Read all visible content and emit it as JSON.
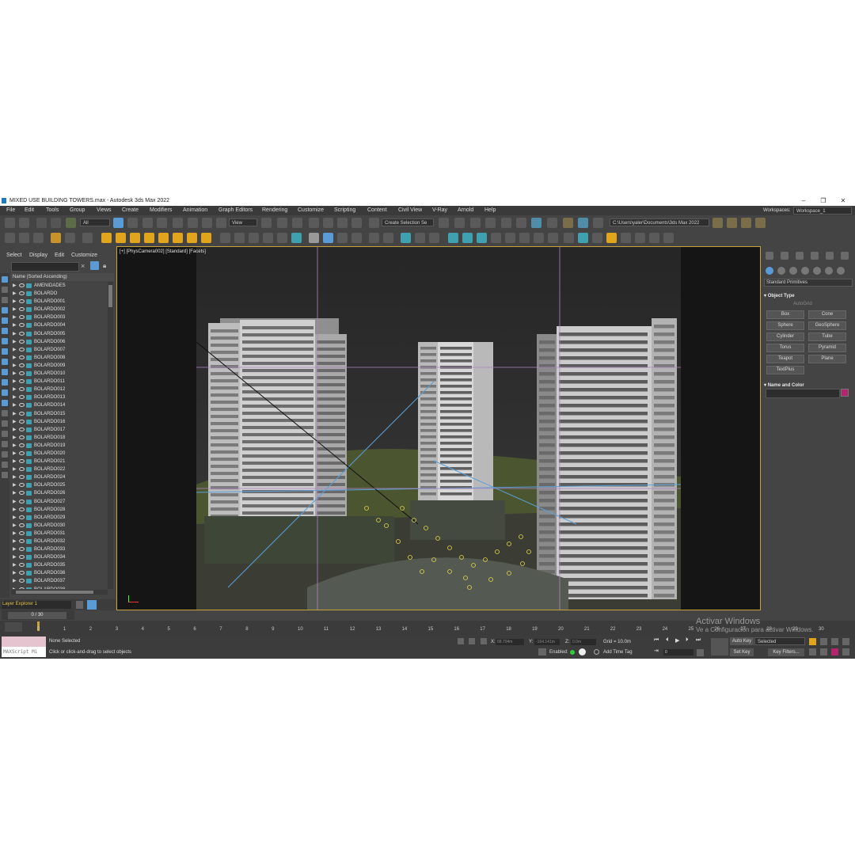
{
  "window": {
    "title": "MIXED USE BUILDING TOWERS.max - Autodesk 3ds Max 2022",
    "minimize": "–",
    "maximize": "❐",
    "close": "✕"
  },
  "menu": [
    "File",
    "Edit",
    "Tools",
    "Group",
    "Views",
    "Create",
    "Modifiers",
    "Animation",
    "Graph Editors",
    "Rendering",
    "Customize",
    "Scripting",
    "Content",
    "Civil View",
    "V-Ray",
    "Arnold",
    "Help"
  ],
  "workspaces": {
    "label": "Workspaces:",
    "value": "Workspace_1"
  },
  "toolbar": {
    "filter_value": "All",
    "view_value": "View",
    "selection_set": "Create Selection Se",
    "project_path": "C:\\Users\\yaler\\Documents\\3ds Max 2022"
  },
  "scene_explorer": {
    "menu": [
      "Select",
      "Display",
      "Edit",
      "Customize"
    ],
    "column_header": "Name (Sorted Ascending)",
    "items": [
      "AMENIDADES",
      "BOLARDO",
      "BOLARDO001",
      "BOLARDO002",
      "BOLARDO003",
      "BOLARDO004",
      "BOLARDO005",
      "BOLARDO006",
      "BOLARDO007",
      "BOLARDO008",
      "BOLARDO009",
      "BOLARDO010",
      "BOLARDO011",
      "BOLARDO012",
      "BOLARDO013",
      "BOLARDO014",
      "BOLARDO015",
      "BOLARDO016",
      "BOLARDO017",
      "BOLARDO018",
      "BOLARDO019",
      "BOLARDO020",
      "BOLARDO021",
      "BOLARDO022",
      "BOLARDO024",
      "BOLARDO025",
      "BOLARDO026",
      "BOLARDO027",
      "BOLARDO028",
      "BOLARDO029",
      "BOLARDO030",
      "BOLARDO031",
      "BOLARDO032",
      "BOLARDO033",
      "BOLARDO034",
      "BOLARDO035",
      "BOLARDO036",
      "BOLARDO037",
      "BOLARDO038"
    ],
    "layer_explorer": "Layer Explorer 1"
  },
  "viewport": {
    "label_plus": "[+]",
    "label_camera": "[PhysCamera002]",
    "label_shading": "[Standard]",
    "label_mode": "[Facets]"
  },
  "command_panel": {
    "category": "Standard Primitives",
    "object_type_title": "Object Type",
    "autogrid": "AutoGrid",
    "primitives": [
      "Box",
      "Cone",
      "Sphere",
      "GeoSphere",
      "Cylinder",
      "Tube",
      "Torus",
      "Pyramid",
      "Teapot",
      "Plane",
      "TextPlus"
    ],
    "name_color_title": "Name and Color",
    "color": "#b2246e"
  },
  "timeline": {
    "frame_counter": "0 / 30",
    "ticks": [
      "0",
      "1",
      "2",
      "3",
      "4",
      "5",
      "6",
      "7",
      "8",
      "9",
      "10",
      "11",
      "12",
      "13",
      "14",
      "15",
      "16",
      "17",
      "18",
      "19",
      "20",
      "21",
      "22",
      "23",
      "24",
      "25",
      "26",
      "27",
      "28",
      "29",
      "30"
    ]
  },
  "status": {
    "maxscript": "MAXScript Mi",
    "selection": "None Selected",
    "prompt": "Click or click-and-drag to select objects",
    "x_label": "X:",
    "x_value": "68.704m",
    "y_label": "Y:",
    "y_value": "-164.141m",
    "z_label": "Z:",
    "z_value": "0.0m",
    "grid": "Grid = 10.0m",
    "enabled_label": "Enabled:",
    "add_time_tag": "Add Time Tag",
    "auto_key": "Auto Key",
    "set_key": "Set Key",
    "selected": "Selected",
    "key_filters": "Key Filters...",
    "current_frame": "0"
  },
  "watermark": {
    "line1": "Activar Windows",
    "line2": "Ve a Configuración para activar Windows."
  }
}
